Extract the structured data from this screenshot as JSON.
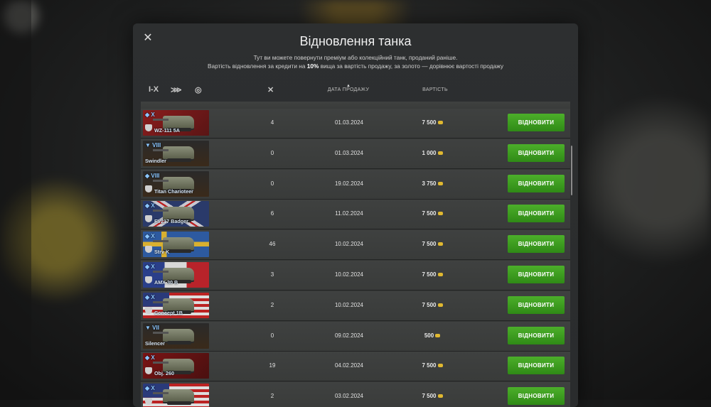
{
  "dialog": {
    "title": "Відновлення танка",
    "subtitle_line1": "Тут ви можете повернути преміум або колекційний танк, проданий раніше.",
    "subtitle_line2_pre": "Вартість відновлення за кредити на ",
    "subtitle_line2_bold": "10%",
    "subtitle_line2_post": " вища за вартість продажу, за золото — дорівнює вартості продажу",
    "close_icon": "close-icon"
  },
  "header": {
    "filter_tier_label": "I-X",
    "date_label": "ДАТА ПРОДАЖУ",
    "price_label": "ВАРТІСТЬ",
    "sort_arrow": "▲"
  },
  "colors": {
    "accent_green": "#3f9f22",
    "tier_blue": "#8ac6ff",
    "gold": "#e0b830"
  },
  "rows": [
    {
      "tier": "X",
      "name": "WZ-111 5A",
      "nation": "cn",
      "premium": true,
      "battles": "4",
      "date": "01.03.2024",
      "price": "7 500",
      "action": "ВІДНОВИТИ"
    },
    {
      "tier": "VIII",
      "name": "Swindler",
      "nation": "de",
      "premium": false,
      "battles": "0",
      "date": "01.03.2024",
      "price": "1 000",
      "action": "ВІДНОВИТИ"
    },
    {
      "tier": "VIII",
      "name": "Titan Charioteer",
      "nation": "de",
      "premium": true,
      "battles": "0",
      "date": "19.02.2024",
      "price": "3 750",
      "action": "ВІДНОВИТИ"
    },
    {
      "tier": "X",
      "name": "FV217 Badger",
      "nation": "gb",
      "premium": true,
      "battles": "6",
      "date": "11.02.2024",
      "price": "7 500",
      "action": "ВІДНОВИТИ"
    },
    {
      "tier": "X",
      "name": "Strv K",
      "nation": "se",
      "premium": true,
      "battles": "46",
      "date": "10.02.2024",
      "price": "7 500",
      "action": "ВІДНОВИТИ"
    },
    {
      "tier": "X",
      "name": "AMX 30 B",
      "nation": "fr",
      "premium": true,
      "battles": "3",
      "date": "10.02.2024",
      "price": "7 500",
      "action": "ВІДНОВИТИ"
    },
    {
      "tier": "X",
      "name": "Concept 1B",
      "nation": "us",
      "premium": true,
      "battles": "2",
      "date": "10.02.2024",
      "price": "7 500",
      "action": "ВІДНОВИТИ"
    },
    {
      "tier": "VII",
      "name": "Silencer",
      "nation": "de",
      "premium": false,
      "battles": "0",
      "date": "09.02.2024",
      "price": "500",
      "action": "ВІДНОВИТИ"
    },
    {
      "tier": "X",
      "name": "Obj. 260",
      "nation": "ussr",
      "premium": true,
      "battles": "19",
      "date": "04.02.2024",
      "price": "7 500",
      "action": "ВІДНОВИТИ"
    },
    {
      "tier": "X",
      "name": "",
      "nation": "us",
      "premium": true,
      "battles": "2",
      "date": "03.02.2024",
      "price": "7 500",
      "action": "ВІДНОВИТИ"
    }
  ]
}
